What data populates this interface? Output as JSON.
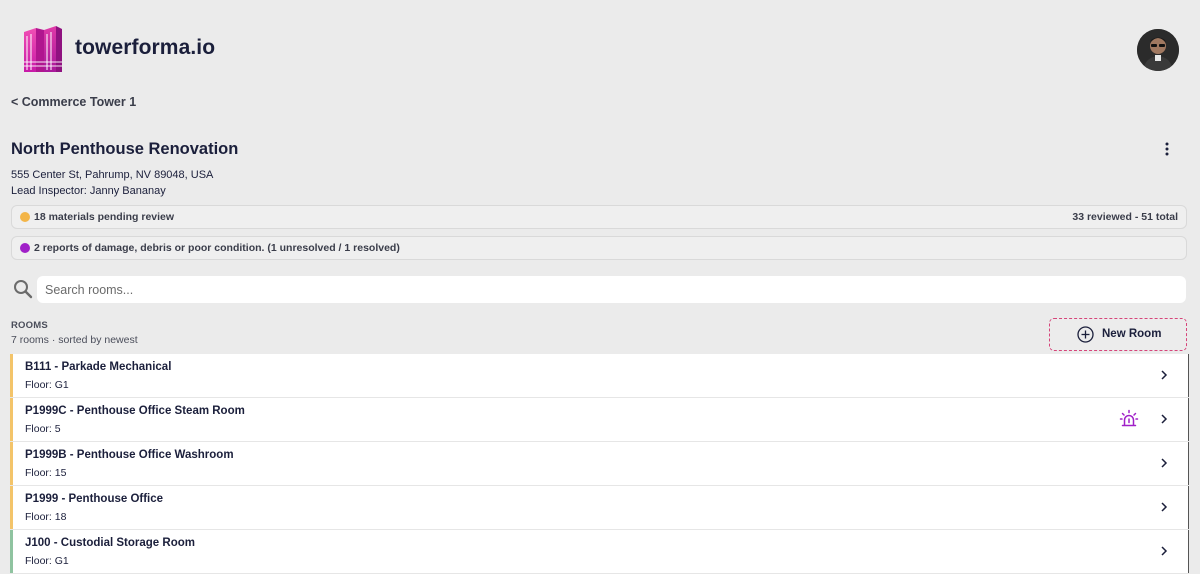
{
  "header": {
    "brand": "towerforma.io",
    "logo_icon": "building-logo-icon",
    "avatar_icon": "user-avatar"
  },
  "breadcrumb": {
    "back_label": "< Commerce Tower 1"
  },
  "project": {
    "title": "North Penthouse Renovation",
    "address": "555 Center St, Pahrump, NV 89048, USA",
    "inspector": "Lead Inspector: Janny Bananay"
  },
  "status": {
    "materials": {
      "text": "18 materials pending review",
      "summary": "33 reviewed - 51 total",
      "color": "#f3b548"
    },
    "damage": {
      "text": "2 reports of damage, debris or poor condition. (1 unresolved / 1 resolved)",
      "color": "#a020c8"
    }
  },
  "search": {
    "placeholder": "Search rooms..."
  },
  "rooms": {
    "heading": "ROOMS",
    "meta": "7 rooms · sorted by newest",
    "new_room_label": "New Room",
    "items": [
      {
        "name": "B111 - Parkade Mechanical",
        "floor": "Floor: G1",
        "accent": "#f3c46a",
        "alarm": false
      },
      {
        "name": "P1999C - Penthouse Office Steam Room",
        "floor": "Floor: 5",
        "accent": "#f3c46a",
        "alarm": true
      },
      {
        "name": "P1999B - Penthouse Office Washroom",
        "floor": "Floor: 15",
        "accent": "#f3c46a",
        "alarm": false
      },
      {
        "name": "P1999 - Penthouse Office",
        "floor": "Floor: 18",
        "accent": "#f3c46a",
        "alarm": false
      },
      {
        "name": "J100 - Custodial Storage Room",
        "floor": "Floor: G1",
        "accent": "#8fc3a0",
        "alarm": false
      }
    ]
  },
  "colors": {
    "brand_magenta": "#d61fa0",
    "alarm_purple": "#a020c8",
    "new_room_border": "#d6457a"
  }
}
